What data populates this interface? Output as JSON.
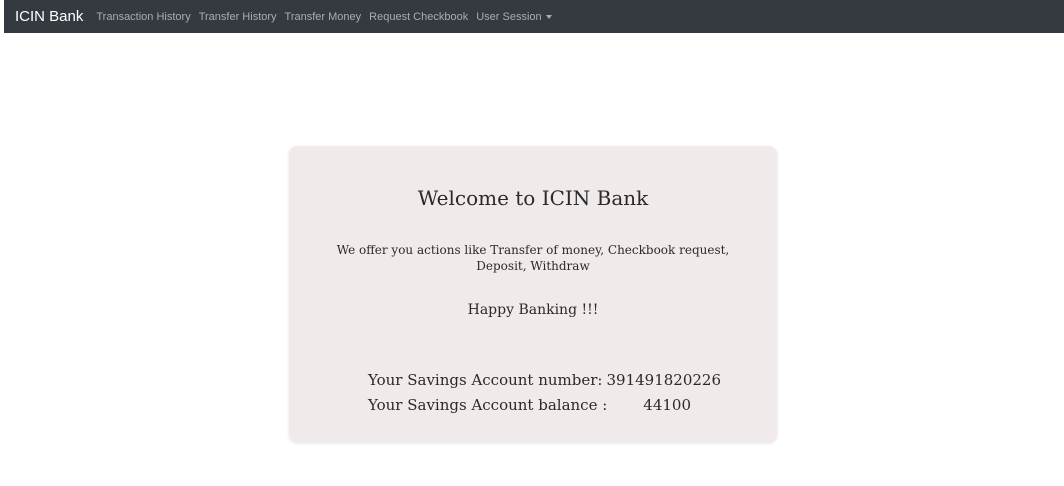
{
  "navbar": {
    "brand": "ICIN Bank",
    "links": [
      "Transaction History",
      "Transfer History",
      "Transfer Money",
      "Request Checkbook"
    ],
    "dropdown_label": "User Session",
    "dropdown_icon": "caret-down-icon"
  },
  "card": {
    "title": "Welcome to ICIN Bank",
    "offer_text": "We offer you actions like Transfer of money, Checkbook request, Deposit, Withdraw",
    "happy_text": "Happy Banking !!!",
    "account_number_label": "Your Savings Account number:",
    "account_number": "391491820226",
    "account_balance_label": "Your Savings Account balance :",
    "account_balance": "44100"
  },
  "colors": {
    "navbar_bg": "#343a40",
    "card_bg": "#f1eaea",
    "nav_link": "#a9adb2"
  }
}
